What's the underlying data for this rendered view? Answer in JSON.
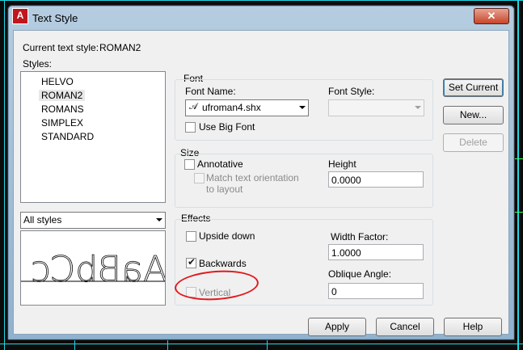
{
  "window": {
    "title": "Text Style",
    "close_symbol": "✕",
    "app_badge": "A"
  },
  "current_style": {
    "label": "Current text style:",
    "value": "ROMAN2"
  },
  "styles": {
    "label": "Styles:",
    "items": [
      "HELVO",
      "ROMAN2",
      "ROMANS",
      "SIMPLEX",
      "STANDARD"
    ],
    "selected": "ROMAN2",
    "filter": "All styles"
  },
  "preview": {
    "text": "AaBbCc"
  },
  "font": {
    "group": "Font",
    "name_label": "Font Name:",
    "name_value": "ufroman4.shx",
    "style_label": "Font Style:",
    "style_value": "",
    "big_font_label": "Use Big Font"
  },
  "size": {
    "group": "Size",
    "annotative_label": "Annotative",
    "match_label_line1": "Match text orientation",
    "match_label_line2": "to layout",
    "height_label": "Height",
    "height_value": "0.0000"
  },
  "effects": {
    "group": "Effects",
    "upside_down_label": "Upside down",
    "backwards_label": "Backwards",
    "backwards_checked": true,
    "vertical_label": "Vertical",
    "width_label": "Width Factor:",
    "width_value": "1.0000",
    "oblique_label": "Oblique Angle:",
    "oblique_value": "0"
  },
  "buttons": {
    "set_current": "Set Current",
    "new": "New...",
    "delete": "Delete",
    "apply": "Apply",
    "cancel": "Cancel",
    "help": "Help"
  },
  "colors": {
    "annotation": "#e0191c",
    "cad_cyan": "#1fd8e6",
    "cad_green": "#3cff5a"
  }
}
